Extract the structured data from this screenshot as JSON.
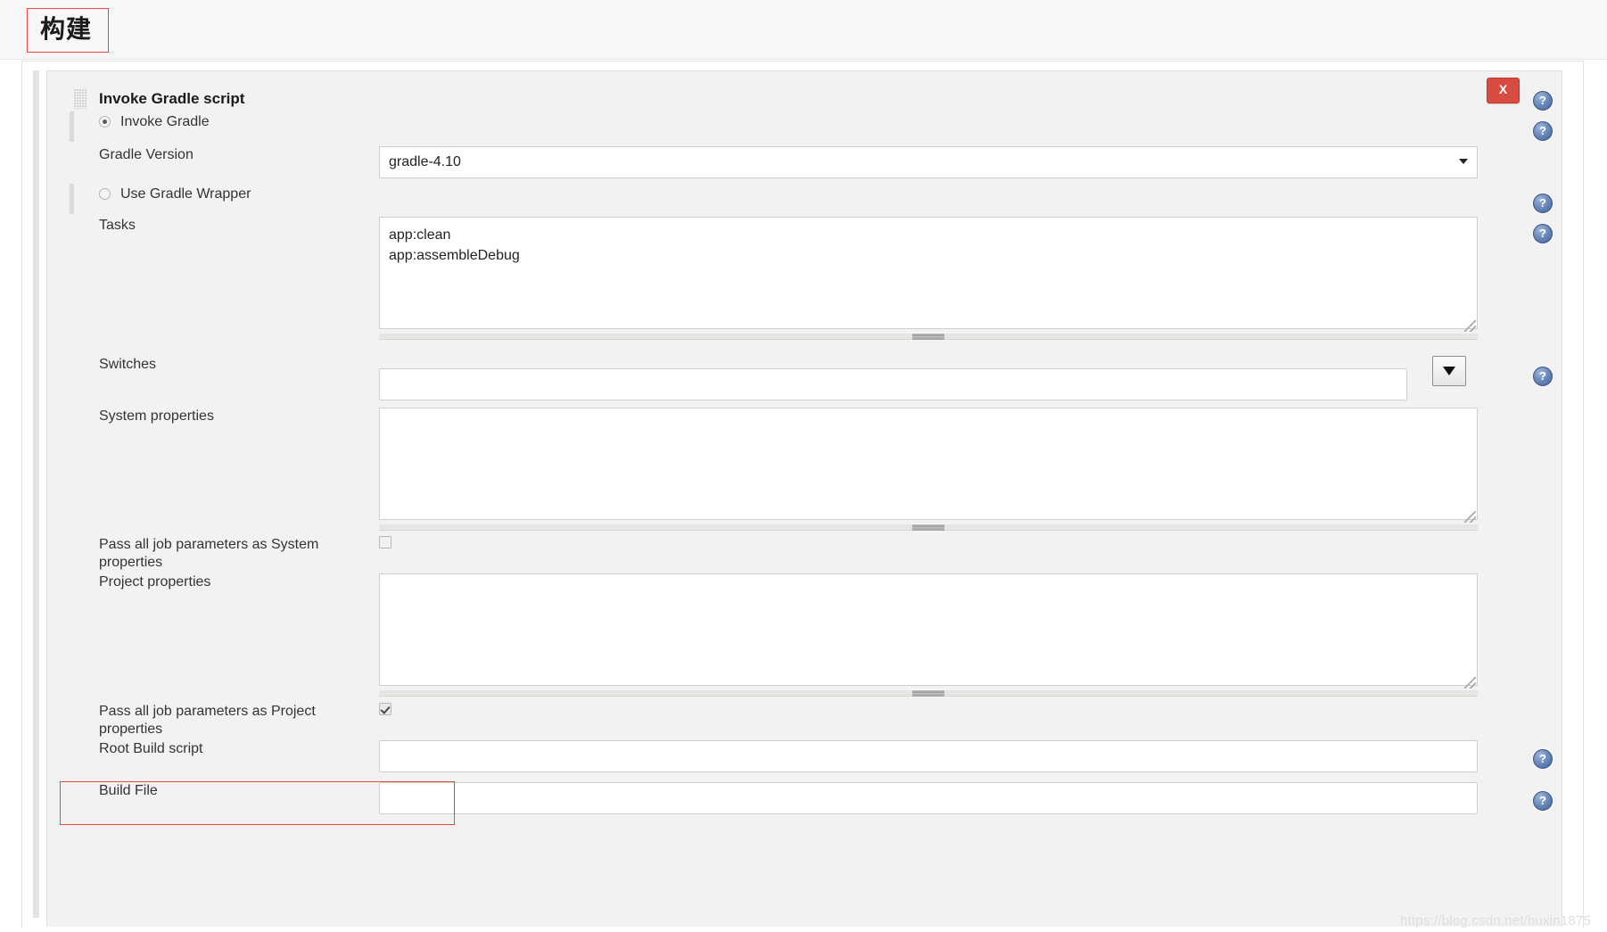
{
  "page": {
    "title": "构建"
  },
  "builder": {
    "title": "Invoke Gradle script",
    "drag_handle_icon": "drag-dots-icon",
    "delete_label": "X",
    "help_icon": "help-circle-icon"
  },
  "radios": [
    {
      "label": "Invoke Gradle",
      "checked": true
    },
    {
      "label": "Use Gradle Wrapper",
      "checked": false
    }
  ],
  "fields": {
    "gradle_version": {
      "label": "Gradle Version",
      "value": "gradle-4.10",
      "options": [
        "gradle-4.10"
      ],
      "arrow_icon": "chevron-down-icon"
    },
    "tasks": {
      "label": "Tasks",
      "value": "app:clean\napp:assembleDebug",
      "placeholder": ""
    },
    "switches": {
      "label": "Switches",
      "value": "",
      "placeholder": "",
      "dropdown_icon": "triangle-down-icon"
    },
    "system_properties": {
      "label": "System properties",
      "value": "",
      "placeholder": ""
    },
    "pass_system": {
      "label": "Pass all job parameters as System properties",
      "checked": false
    },
    "project_properties": {
      "label": "Project properties",
      "value": "",
      "placeholder": ""
    },
    "pass_project": {
      "label": "Pass all job parameters as Project properties",
      "checked": true
    },
    "root_build_script": {
      "label": "Root Build script",
      "value": "",
      "placeholder": ""
    },
    "build_file": {
      "label": "Build File",
      "value": "",
      "placeholder": ""
    }
  },
  "colors": {
    "annotation": "#e8483f",
    "delete_button": "#d74b41",
    "help_icon": "#40639b",
    "panel_bg": "#f2f2f2"
  },
  "watermark": "https://blog.csdn.net/huxin1875"
}
